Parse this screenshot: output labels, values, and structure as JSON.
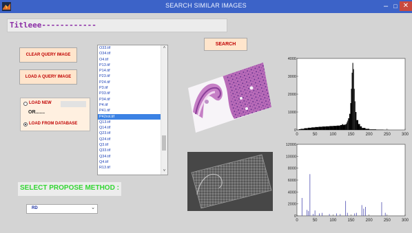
{
  "window": {
    "title": "SEARCH SIMILAR IMAGES"
  },
  "title_field": {
    "text": "Titleee------------"
  },
  "buttons": {
    "clear_query": "CLEAR QUERY IMAGE",
    "load_query": "LOAD A QUERY IMAGE",
    "search": "SEARCH"
  },
  "source": {
    "load_new": "LOAD NEW",
    "or": "OR.......",
    "load_from_db": "LOAD FROM DATABASE",
    "selected": "LOAD FROM DATABASE"
  },
  "file_list": {
    "items": [
      "O33.tif",
      "O34.tif",
      "O4.tif",
      "P13.tif",
      "P14.tif",
      "P23.tif",
      "P24.tif",
      "P3.tif",
      "P33.tif",
      "P34.tif",
      "P4.tif",
      "P41.tif",
      "P42rot.tif",
      "Q13.tif",
      "Q14.tif",
      "Q23.tif",
      "Q24.tif",
      "Q3.tif",
      "Q33.tif",
      "Q34.tif",
      "Q4.tif",
      "R13.tif"
    ],
    "selected": "P42rot.tif"
  },
  "method": {
    "label": "SELECT PROPOSE METHOD :",
    "value": "RD"
  },
  "chart_data": [
    {
      "type": "bar",
      "title": "",
      "xlabel": "",
      "ylabel": "",
      "xlim": [
        0,
        300
      ],
      "ylim": [
        0,
        4000
      ],
      "xticks": [
        0,
        50,
        100,
        150,
        200,
        250,
        300
      ],
      "yticks": [
        0,
        1000,
        2000,
        3000,
        4000
      ],
      "x": [
        0,
        5,
        10,
        20,
        30,
        40,
        50,
        60,
        70,
        80,
        90,
        100,
        110,
        120,
        125,
        128,
        130,
        135,
        138,
        140,
        142,
        145,
        148,
        150,
        152,
        154,
        156,
        158,
        160,
        162,
        165,
        170,
        175,
        180,
        190,
        200,
        220,
        240,
        255
      ],
      "values": [
        0,
        40,
        60,
        95,
        120,
        140,
        160,
        175,
        190,
        200,
        215,
        225,
        240,
        270,
        320,
        280,
        290,
        330,
        420,
        520,
        650,
        900,
        1500,
        2300,
        3200,
        3750,
        3400,
        2300,
        1600,
        1000,
        550,
        330,
        200,
        110,
        60,
        30,
        15,
        5,
        0
      ]
    },
    {
      "type": "bar",
      "title": "",
      "xlabel": "",
      "ylabel": "",
      "xlim": [
        0,
        300
      ],
      "ylim": [
        0,
        12000
      ],
      "xticks": [
        0,
        50,
        100,
        150,
        200,
        250,
        300
      ],
      "yticks": [
        0,
        2000,
        4000,
        6000,
        8000,
        10000,
        12000
      ],
      "x": [
        14,
        28,
        32,
        36,
        45,
        50,
        62,
        70,
        90,
        110,
        120,
        135,
        140,
        160,
        165,
        180,
        185,
        190,
        235,
        245
      ],
      "values": [
        3000,
        1000,
        800,
        7000,
        300,
        900,
        400,
        500,
        300,
        400,
        300,
        2500,
        500,
        400,
        500,
        1800,
        1200,
        1500,
        2300,
        500
      ]
    }
  ]
}
